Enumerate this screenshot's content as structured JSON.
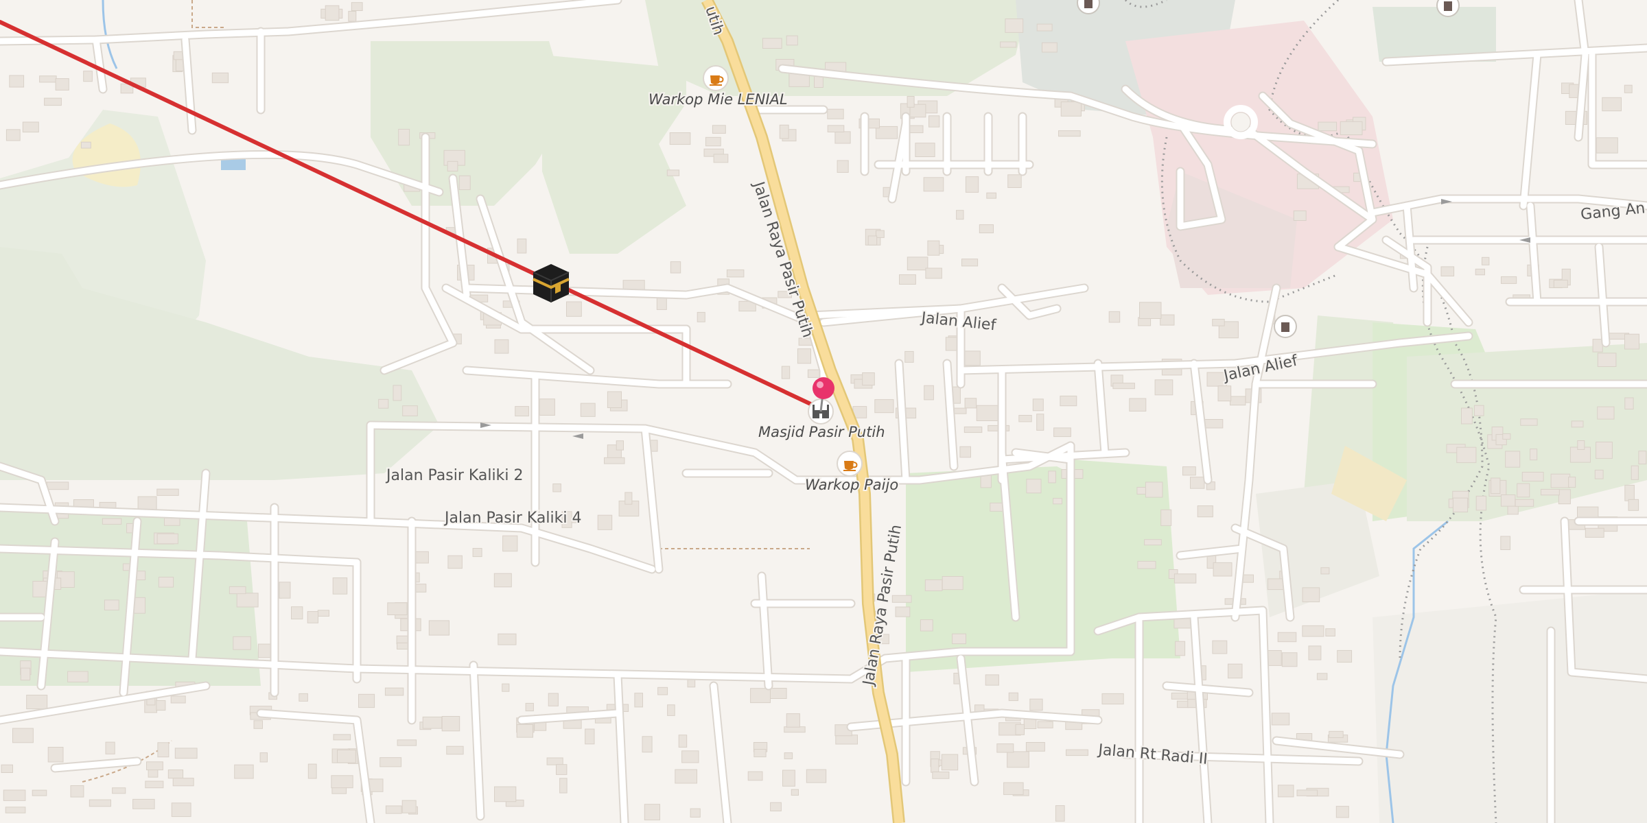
{
  "map": {
    "places": [
      {
        "id": "warkop-mie-lenial",
        "label": "Warkop Mie LENIAL",
        "icon": "cafe-icon"
      },
      {
        "id": "masjid-pasir-putih",
        "label": "Masjid Pasir Putih",
        "icon": "mosque-icon"
      },
      {
        "id": "warkop-paijo",
        "label": "Warkop Paijo",
        "icon": "cafe-icon"
      }
    ],
    "roads": [
      {
        "id": "jalan-raya-pasir-putih-top",
        "label": "Jalan Raya Pasir Putih"
      },
      {
        "id": "jalan-raya-pasir-putih-bottom",
        "label": "Jalan Raya Pasir Putih"
      },
      {
        "id": "jalan-raya-pasir-putih-topcut",
        "label": "utih"
      },
      {
        "id": "jalan-alief-1",
        "label": "Jalan Alief"
      },
      {
        "id": "jalan-alief-2",
        "label": "Jalan Alief"
      },
      {
        "id": "jalan-pasir-kaliki-2",
        "label": "Jalan Pasir Kaliki 2"
      },
      {
        "id": "jalan-pasir-kaliki-4",
        "label": "Jalan Pasir Kaliki 4"
      },
      {
        "id": "jalan-rt-radi-ii",
        "label": "Jalan Rt Radi II"
      },
      {
        "id": "gang-an",
        "label": "Gang An"
      }
    ],
    "markers": {
      "qibla_icon": "kaaba-icon",
      "pin_icon": "location-pin-icon",
      "qibla_line_color": "#d63031",
      "pin_color": "#e8336b"
    }
  }
}
